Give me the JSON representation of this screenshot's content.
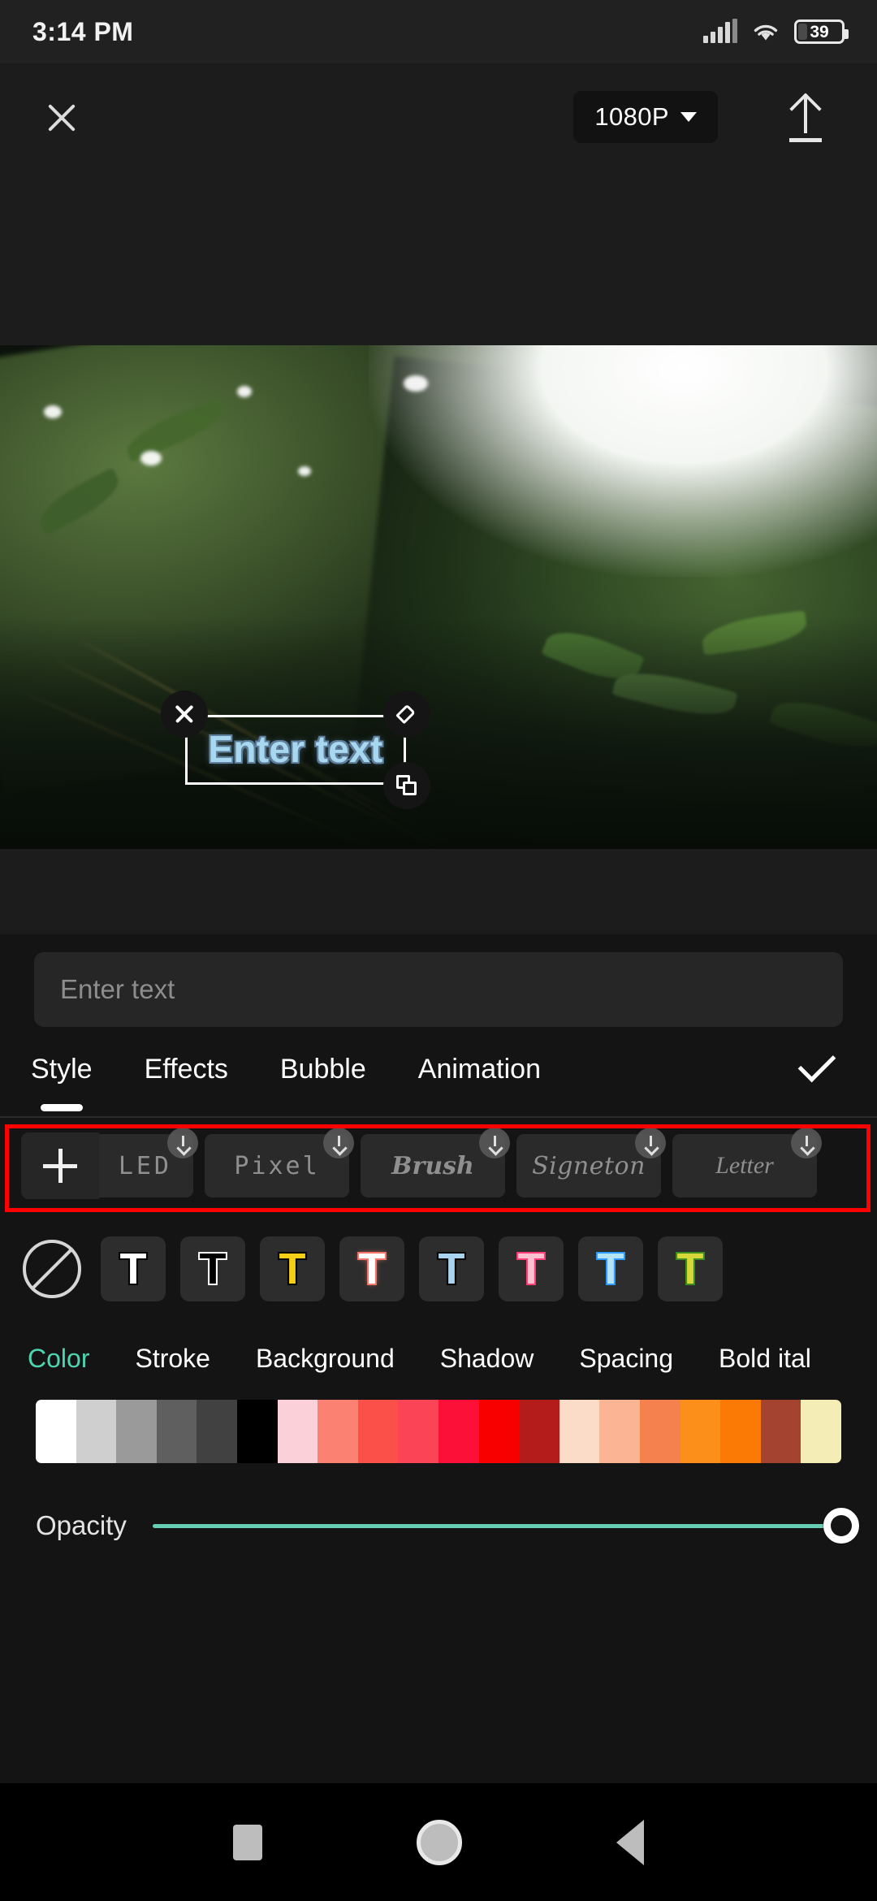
{
  "statusbar": {
    "time": "3:14 PM",
    "battery_percent": "39",
    "signal_icon": "signal-bars-icon",
    "wifi_icon": "wifi-icon",
    "battery_icon": "battery-icon"
  },
  "toolbar": {
    "close_icon": "close-icon",
    "quality_label": "1080P",
    "quality_caret_icon": "chevron-down-icon",
    "export_icon": "export-upload-icon"
  },
  "preview": {
    "overlay_text": "Enter text",
    "overlay_text_color": "#a8d8ef",
    "overlay_shadow_color": "#5f7f9c",
    "handle_delete_icon": "close-icon",
    "handle_edit_icon": "pencil-icon",
    "handle_duplicate_icon": "duplicate-icon"
  },
  "editor": {
    "input_placeholder": "Enter text",
    "input_value": "",
    "tabs": [
      {
        "label": "Style",
        "active": true
      },
      {
        "label": "Effects",
        "active": false
      },
      {
        "label": "Bubble",
        "active": false
      },
      {
        "label": "Animation",
        "active": false
      }
    ],
    "confirm_icon": "checkmark-icon",
    "add_font_icon": "plus-icon",
    "download_badge_icon": "download-arrow-icon",
    "fonts": [
      {
        "name": "LED",
        "downloadable": true
      },
      {
        "name": "Pixel",
        "downloadable": true
      },
      {
        "name": "Brush",
        "downloadable": true
      },
      {
        "name": "Signeton",
        "downloadable": true
      },
      {
        "name": "Letter",
        "downloadable": true
      }
    ],
    "annotation": {
      "color": "#ff0000",
      "target": "font-style-row"
    },
    "no_style_icon": "no-style-circle-slash-icon",
    "text_presets": [
      {
        "name": "white",
        "fill": "#ffffff",
        "outline": "#000000"
      },
      {
        "name": "black-outline",
        "fill": "#000000",
        "outline": "#ffffff"
      },
      {
        "name": "yellow",
        "fill": "#f5cf16",
        "outline": "#000000"
      },
      {
        "name": "red-glow",
        "fill": "#ffffff",
        "outline": "#f4776a"
      },
      {
        "name": "light-blue",
        "fill": "#a8d4ef",
        "outline": "#000000"
      },
      {
        "name": "pink",
        "fill": "#ffc0d0",
        "outline": "#ff3d7a"
      },
      {
        "name": "cyan-blue",
        "fill": "#b6e4f7",
        "outline": "#2e9bff"
      },
      {
        "name": "yellow-green",
        "fill": "#d8d73a",
        "outline": "#3c8f1e"
      }
    ],
    "property_tabs": [
      {
        "label": "Color",
        "active": true
      },
      {
        "label": "Stroke",
        "active": false
      },
      {
        "label": "Background",
        "active": false
      },
      {
        "label": "Shadow",
        "active": false
      },
      {
        "label": "Spacing",
        "active": false
      },
      {
        "label": "Bold ital",
        "active": false
      }
    ],
    "active_property_color": "#4fd4b0",
    "color_swatches": [
      "#ffffff",
      "#cfcfcf",
      "#9a9a9a",
      "#5f5f5f",
      "#414141",
      "#000000",
      "#fbd0d8",
      "#fb8272",
      "#fb4f4a",
      "#fc4457",
      "#fd1038",
      "#f90000",
      "#b41b1b",
      "#fbdcc9",
      "#fbb494",
      "#f5814f",
      "#fb8f1a",
      "#fa7a05",
      "#a4432f",
      "#f4eeb6"
    ],
    "opacity": {
      "label": "Opacity",
      "value": 100,
      "track_color": "#67cdb4"
    }
  },
  "navbar": {
    "recents_icon": "square-recents-icon",
    "home_icon": "circle-home-icon",
    "back_icon": "triangle-back-icon"
  }
}
